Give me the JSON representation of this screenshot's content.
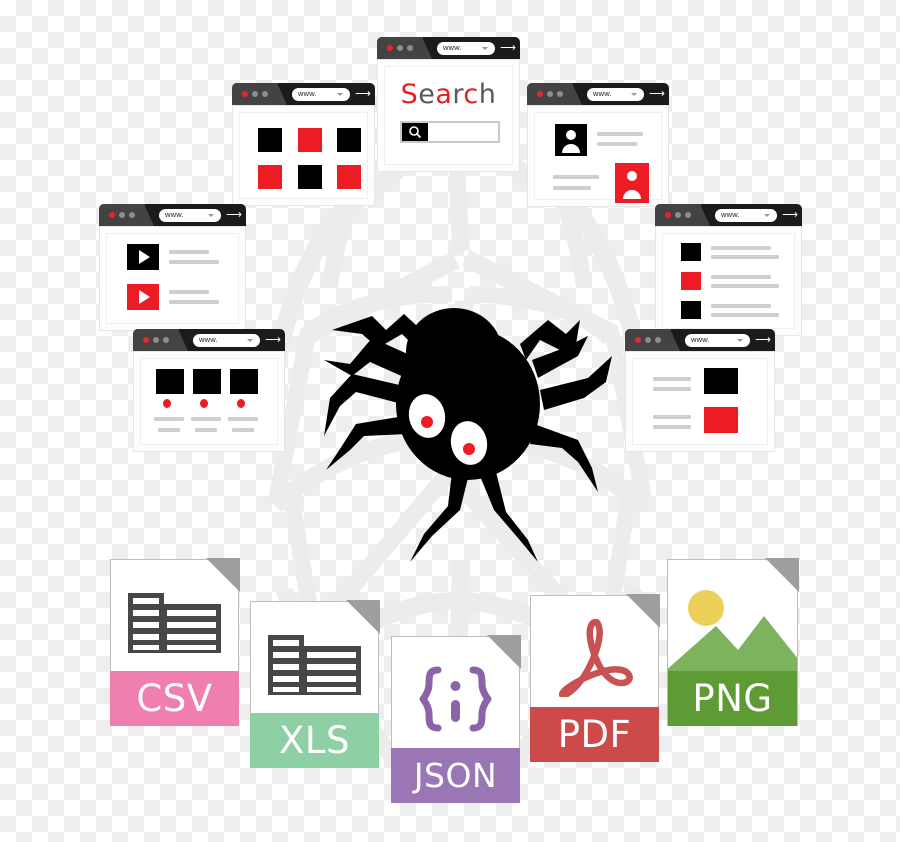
{
  "illustration": {
    "title": "Web scraping spider with browser windows and export file formats",
    "colors": {
      "red": "#ed1c24",
      "black": "#000000",
      "dark_gray": "#434343",
      "bar_black": "#1b1b1b",
      "line_gray": "#cfcfcf",
      "web_gray": "#ececec",
      "csv_pink": "#ef7fae",
      "xls_green": "#8ecfa3",
      "json_purple": "#9b76b5",
      "pdf_red": "#cc4a4a",
      "png_green": "#5f9b35",
      "png_hill": "#7cb35c",
      "png_sun": "#ecd05a",
      "fold_gray": "#9e9e9e"
    }
  },
  "browser_windows": [
    {
      "id": "search",
      "name": "search-window",
      "url": "www.",
      "go_icon": "arrow-right-icon",
      "dots": [
        "red",
        "gray",
        "gray"
      ],
      "heading": "Search",
      "heading_letters": [
        {
          "char": "S",
          "color": "red"
        },
        {
          "char": "e",
          "color": "dark"
        },
        {
          "char": "a",
          "color": "red"
        },
        {
          "char": "r",
          "color": "dark"
        },
        {
          "char": "c",
          "color": "red"
        },
        {
          "char": "h",
          "color": "dark"
        }
      ],
      "search_input_value": "",
      "search_icon": "magnifier-icon"
    },
    {
      "id": "grid",
      "name": "thumbnail-grid-window",
      "url": "www.",
      "go_icon": "arrow-right-icon",
      "dots": [
        "red",
        "gray",
        "gray"
      ],
      "tiles": [
        "black",
        "red",
        "black",
        "red",
        "black",
        "red"
      ]
    },
    {
      "id": "profiles",
      "name": "profile-cards-window",
      "url": "www.",
      "go_icon": "arrow-right-icon",
      "dots": [
        "red",
        "gray",
        "gray"
      ],
      "cards": [
        {
          "avatar": "black",
          "lines": 2
        },
        {
          "avatar": "red",
          "lines": 2
        }
      ]
    },
    {
      "id": "videos",
      "name": "video-list-window",
      "url": "www.",
      "go_icon": "arrow-right-icon",
      "dots": [
        "red",
        "gray",
        "gray"
      ],
      "items": [
        {
          "thumb": "black",
          "icon": "play-icon",
          "lines": 2
        },
        {
          "thumb": "red",
          "icon": "play-icon",
          "lines": 2
        }
      ]
    },
    {
      "id": "articles",
      "name": "article-list-window",
      "url": "www.",
      "go_icon": "arrow-right-icon",
      "dots": [
        "red",
        "gray",
        "gray"
      ],
      "items": [
        {
          "thumb": "black",
          "lines": 2
        },
        {
          "thumb": "red",
          "lines": 2
        },
        {
          "thumb": "black",
          "lines": 2
        }
      ]
    },
    {
      "id": "products",
      "name": "product-grid-window",
      "url": "www.",
      "go_icon": "arrow-right-icon",
      "dots": [
        "red",
        "gray",
        "gray"
      ],
      "columns": [
        {
          "thumb": "black",
          "badge": "red-dot",
          "lines": 2
        },
        {
          "thumb": "black",
          "badge": "red-dot",
          "lines": 2
        },
        {
          "thumb": "black",
          "badge": "red-dot",
          "lines": 2
        }
      ]
    },
    {
      "id": "media",
      "name": "media-list-window",
      "url": "www.",
      "go_icon": "arrow-right-icon",
      "dots": [
        "red",
        "gray",
        "gray"
      ],
      "rows": [
        {
          "lines": 2,
          "thumb": "black"
        },
        {
          "lines": 2,
          "thumb": "red"
        }
      ]
    }
  ],
  "spider": {
    "name": "spider-mascot",
    "body_color": "#000000",
    "eye_color": "#ffffff",
    "pupil_color": "#ed1c24",
    "leg_count": 8
  },
  "web_background": {
    "name": "spider-web-background",
    "color": "#ececec"
  },
  "file_formats": [
    {
      "label": "CSV",
      "name": "file-icon-csv",
      "band_color": "#ef7fae",
      "glyph": "table-icon"
    },
    {
      "label": "XLS",
      "name": "file-icon-xls",
      "band_color": "#8ecfa3",
      "glyph": "table-icon"
    },
    {
      "label": "JSON",
      "name": "file-icon-json",
      "band_color": "#9b76b5",
      "glyph": "braces-icon",
      "glyph_text": "{ }"
    },
    {
      "label": "PDF",
      "name": "file-icon-pdf",
      "band_color": "#cc4a4a",
      "glyph": "acrobat-a-icon"
    },
    {
      "label": "PNG",
      "name": "file-icon-png",
      "band_color": "#5f9b35",
      "glyph": "image-landscape-icon"
    }
  ]
}
